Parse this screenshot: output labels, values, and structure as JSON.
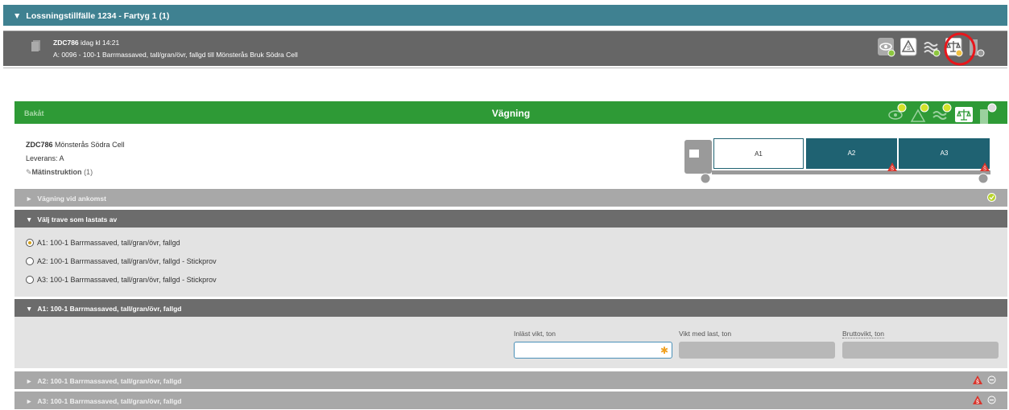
{
  "header": {
    "title": "Lossningstillfälle 1234 - Fartyg 1 (1)"
  },
  "vehicle": {
    "reg": "ZDC786",
    "time": "idag kl 14:21",
    "route": "A: 0096 - 100-1 Barrmassaved, tall/gran/övr, fallgd till Mönsterås Bruk Södra Cell"
  },
  "weighing": {
    "back_label": "Bakåt",
    "title": "Vägning",
    "reg": "ZDC786",
    "destination": "Mönsterås Södra Cell",
    "delivery": "Leverans: A",
    "instruction_label": "Mätinstruktion",
    "instruction_count": "(1)"
  },
  "compartments": [
    "A1",
    "A2",
    "A3"
  ],
  "sections": {
    "arrival": "Vägning vid ankomst",
    "choose": "Välj trave som lastats av",
    "a1": "A1: 100-1 Barrmassaved, tall/gran/övr, fallgd",
    "a2": "A2: 100-1 Barrmassaved, tall/gran/övr, fallgd",
    "a3": "A3: 100-1 Barrmassaved, tall/gran/övr, fallgd"
  },
  "options": [
    {
      "label": "A1: 100-1 Barrmassaved, tall/gran/övr, fallgd",
      "selected": true
    },
    {
      "label": "A2: 100-1 Barrmassaved, tall/gran/övr, fallgd - Stickprov",
      "selected": false
    },
    {
      "label": "A3: 100-1 Barrmassaved, tall/gran/övr, fallgd - Stickprov",
      "selected": false
    }
  ],
  "fields": {
    "read_weight": "Inläst vikt, ton",
    "weight_with_load": "Vikt med last, ton",
    "gross_weight": "Bruttovikt, ton"
  },
  "colors": {
    "teal": "#3f8191",
    "green": "#2e9a36",
    "dark_teal": "#1f6272",
    "warning": "#d9342b"
  },
  "icons": [
    "eye-icon",
    "warning-icon",
    "wave-icon",
    "scale-icon",
    "unload-icon"
  ]
}
